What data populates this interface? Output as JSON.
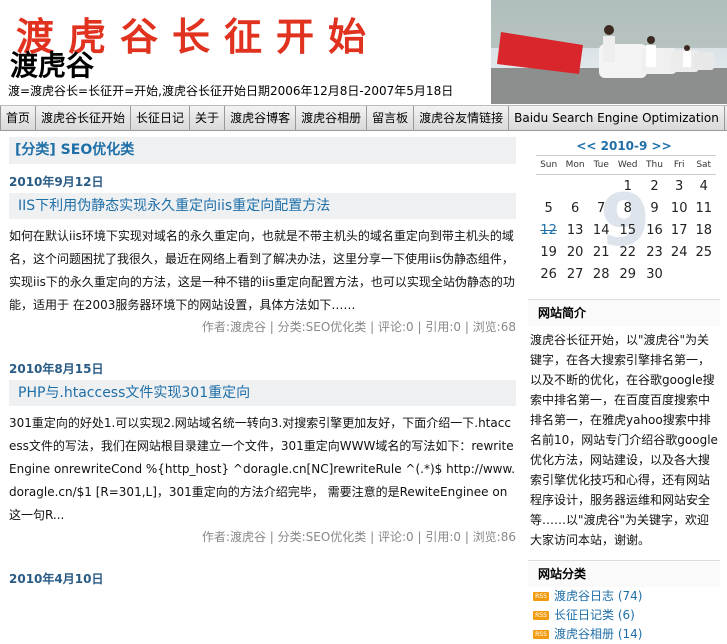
{
  "header": {
    "banner_title": "渡虎谷长征开始",
    "site_name": "渡虎谷",
    "description": "渡=渡虎谷长=长征开=开始,渡虎谷长征开始日期2006年12月8日-2007年5月18日"
  },
  "nav": [
    "首页",
    "渡虎谷长征开始",
    "长征日记",
    "关于",
    "渡虎谷博客",
    "渡虎谷相册",
    "留言板",
    "渡虎谷友情链接",
    "Baidu Search Engine Optimization"
  ],
  "category": "[分类] SEO优化类",
  "posts": [
    {
      "date": "2010年9月12日",
      "title": "IIS下利用伪静态实现永久重定向iis重定向配置方法",
      "body": "如何在默认iis环境下实现对域名的永久重定向，也就是不带主机头的域名重定向到带主机头的域名，这个问题困扰了我很久，最近在网络上看到了解决办法，这里分享一下使用iis伪静态组件，实现iis下的永久重定向的方法，这是一种不错的iis重定向配置方法，也可以实现全站伪静态的功能，适用于 在2003服务器环境下的网站设置，具体方法如下……",
      "meta": "作者:渡虎谷 | 分类:SEO优化类 | 评论:0 | 引用:0 | 浏览:68"
    },
    {
      "date": "2010年8月15日",
      "title": "PHP与.htaccess文件实现301重定向",
      "body": "301重定向的好处1.可以实现2.网站域名统一转向3.对搜索引擎更加友好，下面介绍一下.htaccess文件的写法，我们在网站根目录建立一个文件，301重定向WWW域名的写法如下：rewriteEngine onrewriteCond %{http_host} ^doragle.cn[NC]rewriteRule ^(.*)$ http://www.doragle.cn/$1 [R=301,L]，301重定向的方法介绍完毕， 需要注意的是RewiteEnginee on这一句R...",
      "meta": "作者:渡虎谷 | 分类:SEO优化类 | 评论:0 | 引用:0 | 浏览:86"
    },
    {
      "date": "2010年4月10日"
    }
  ],
  "sidebar": {
    "calendar": {
      "heading": "<< 2010-9 >>",
      "weekdays": [
        "Sun",
        "Mon",
        "Tue",
        "Wed",
        "Thu",
        "Fri",
        "Sat"
      ],
      "weeks": [
        [
          "",
          "",
          "",
          "1",
          "2",
          "3",
          "4"
        ],
        [
          "5",
          "6",
          "7",
          "8",
          "9",
          "10",
          "11"
        ],
        [
          "12",
          "13",
          "14",
          "15",
          "16",
          "17",
          "18"
        ],
        [
          "19",
          "20",
          "21",
          "22",
          "23",
          "24",
          "25"
        ],
        [
          "26",
          "27",
          "28",
          "29",
          "30",
          "",
          ""
        ]
      ],
      "watermark": "9",
      "highlight": "12"
    },
    "about_title": "网站简介",
    "about_text": "渡虎谷长征开始，以\"渡虎谷\"为关键字，在各大搜索引擎排名第一，以及不断的优化，在谷歌google搜索中排名第一，在百度百度搜索中排名第一，在雅虎yahoo搜索中排名前10，网站专门介绍谷歌google优化方法，网站建设，以及各大搜索引擎优化技巧和心得，还有网站程序设计，服务器运维和网站安全等……以\"渡虎谷\"为关键字，欢迎大家访问本站，谢谢。",
    "cat_title": "网站分类",
    "cats": [
      {
        "label": "渡虎谷日志",
        "count": "(74)"
      },
      {
        "label": "长征日记类",
        "count": "(6)"
      },
      {
        "label": "渡虎谷相册",
        "count": "(14)"
      }
    ]
  },
  "colors": {
    "accent": "#1f6fa8",
    "banner": "#e0321f"
  }
}
